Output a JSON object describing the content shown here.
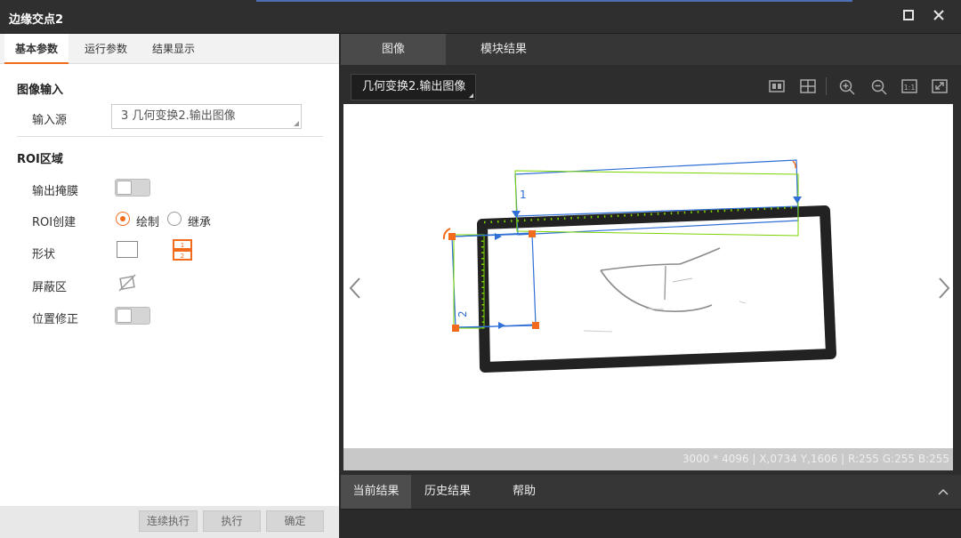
{
  "window": {
    "title": "边缘交点2",
    "maximize_icon": "square-icon",
    "close_icon": "close-icon"
  },
  "left_tabs": [
    {
      "label": "基本参数",
      "active": true
    },
    {
      "label": "运行参数",
      "active": false
    },
    {
      "label": "结果显示",
      "active": false
    }
  ],
  "image_input": {
    "section": "图像输入",
    "source_label": "输入源",
    "source_value": "3 几何变换2.输出图像"
  },
  "roi": {
    "section": "ROI区域",
    "mask_output_label": "输出掩膜",
    "roi_create_label": "ROI创建",
    "roi_create_options": [
      {
        "label": "绘制",
        "selected": true
      },
      {
        "label": "继承",
        "selected": false
      }
    ],
    "shape_label": "形状",
    "mask_area_label": "屏蔽区",
    "position_fix_label": "位置修正"
  },
  "footer_buttons": {
    "continuous": "连续执行",
    "execute": "执行",
    "confirm": "确定"
  },
  "right_tabs": [
    {
      "label": "图像",
      "active": true
    },
    {
      "label": "模块结果",
      "active": false
    }
  ],
  "image_selector": "几何变换2.输出图像",
  "status_text": "3000 * 4096  |  X,0734  Y,1606  |  R:255  G:255  B:255",
  "roi_labels": {
    "roi1": "1",
    "roi2": "2"
  },
  "bottom_tabs": [
    {
      "label": "当前结果",
      "active": true
    },
    {
      "label": "历史结果",
      "active": false
    },
    {
      "label": "帮助",
      "active": false
    }
  ],
  "colors": {
    "accent": "#f26b1d",
    "roi_blue": "#2f6fd6",
    "edge_green": "#7bd400"
  }
}
